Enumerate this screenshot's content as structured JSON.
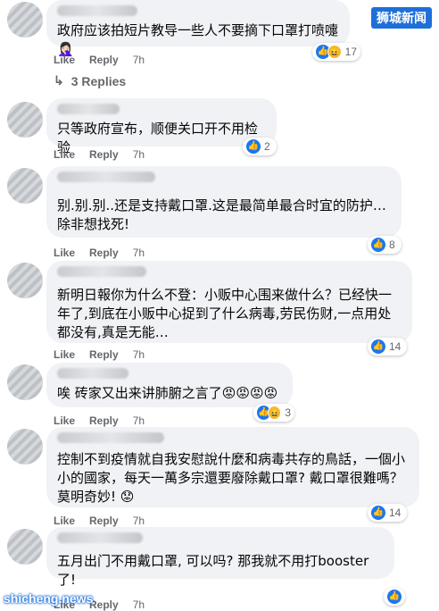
{
  "watermark_top": "狮城新闻",
  "watermark_bottom": "shicheng.news",
  "comments": [
    {
      "text": "政府应该拍短片教导一些人不要摘下口罩打喷嚏🤦🏻‍♀️",
      "like": "Like",
      "reply": "Reply",
      "time": "7h",
      "reaction_count": "17",
      "replies_label": "3 Replies"
    },
    {
      "text": "只等政府宣布，顺便关口开不用检验",
      "like": "Like",
      "reply": "Reply",
      "time": "7h",
      "reaction_count": "2"
    },
    {
      "text": "别.别.别..还是支持戴口罩.这是最简单最合时宜的防护…除非想找死!",
      "like": "Like",
      "reply": "Reply",
      "time": "7h",
      "reaction_count": "8"
    },
    {
      "text": "新明日報你为什么不登：小贩中心围来做什么？已经快一年了,到底在小贩中心捉到了什么病毒,劳民伤财,一点用处都没有,真是无能…",
      "like": "Like",
      "reply": "Reply",
      "time": "7h",
      "reaction_count": "14"
    },
    {
      "text": "唉 砖家又出来讲肺腑之言了😡😡😡😡",
      "like": "Like",
      "reply": "Reply",
      "time": "7h",
      "reaction_count": "3"
    },
    {
      "text": "控制不到疫情就自我安慰說什麼和病毒共存的鳥話，一個小小的國家，每天一萬多宗還要廢除戴口罩? 戴口罩很難嗎？莫明奇妙! 😟",
      "like": "Like",
      "reply": "Reply",
      "time": "7h",
      "reaction_count": "14"
    },
    {
      "text": "五月出门不用戴口罩, 可以吗? 那我就不用打booster 了!",
      "like": "Like",
      "reply": "Reply",
      "time": "7h",
      "reaction_count": ""
    }
  ],
  "icons": {
    "like": "like-thumb-icon",
    "haha": "haha-face-icon",
    "reply_arrow": "reply-arrow-icon"
  },
  "colors": {
    "accent": "#1877f2",
    "bubble": "#f0f2f5",
    "meta": "#65676b"
  }
}
